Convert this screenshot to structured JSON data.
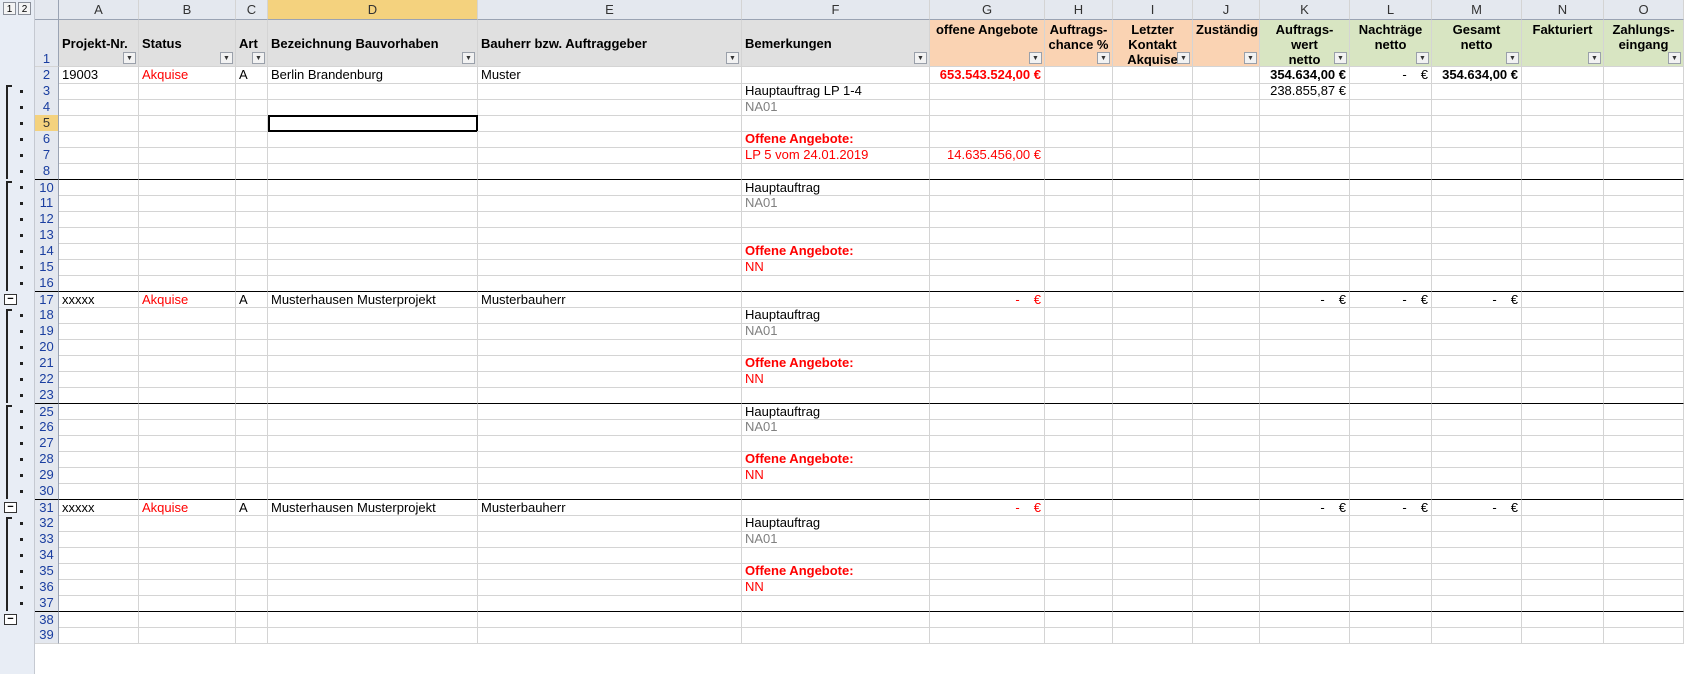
{
  "outline": {
    "levels": [
      "1",
      "2"
    ]
  },
  "columns": [
    "A",
    "B",
    "C",
    "D",
    "E",
    "F",
    "G",
    "H",
    "I",
    "J",
    "K",
    "L",
    "M",
    "N",
    "O"
  ],
  "active_column": "D",
  "header_row_number": "1",
  "headers": {
    "A": "Projekt-Nr.",
    "B": "Status",
    "C": "Art",
    "D": "Bezeichnung Bauvorhaben",
    "E": "Bauherr bzw. Auftraggeber",
    "F": "Bemerkungen",
    "G": "offene Angebote",
    "H": "Auftrags-\nchance %",
    "I": "Letzter\nKontakt\nAkquise",
    "J": "Zuständig",
    "K": "Auftrags-\nwert\nnetto",
    "L": "Nachträge\nnetto",
    "M": "Gesamt\nnetto",
    "N": "Fakturiert",
    "O": "Zahlungs-\neingang"
  },
  "rows": [
    {
      "n": "2",
      "A": "19003",
      "B": "Akquise",
      "C": "A",
      "D": "Berlin Brandenburg",
      "E": "Muster",
      "F": "",
      "G": "653.543.524,00 €",
      "K": "354.634,00 €",
      "L": "-",
      "L2": "€",
      "M": "354.634,00 €"
    },
    {
      "n": "3",
      "F": "Hauptauftrag LP 1-4",
      "K": "238.855,87 €"
    },
    {
      "n": "4",
      "F": "NA01"
    },
    {
      "n": "5",
      "selected": true
    },
    {
      "n": "6",
      "F": "Offene Angebote:"
    },
    {
      "n": "7",
      "F": "LP 5 vom 24.01.2019",
      "G": "14.635.456,00 €"
    },
    {
      "n": "8"
    },
    {
      "n": "10",
      "F": "Hauptauftrag",
      "sep": true
    },
    {
      "n": "11",
      "F": "NA01"
    },
    {
      "n": "12"
    },
    {
      "n": "13"
    },
    {
      "n": "14",
      "F": "Offene Angebote:"
    },
    {
      "n": "15",
      "F": "NN"
    },
    {
      "n": "16"
    },
    {
      "n": "17",
      "A": "xxxxx",
      "B": "Akquise",
      "C": "A",
      "D": "Musterhausen Musterprojekt",
      "E": "Musterbauherr",
      "G": "-",
      "G2": "€",
      "K": "-",
      "K2": "€",
      "L": "-",
      "L2": "€",
      "M": "-",
      "M2": "€",
      "sep": true
    },
    {
      "n": "18",
      "F": "Hauptauftrag"
    },
    {
      "n": "19",
      "F": "NA01"
    },
    {
      "n": "20"
    },
    {
      "n": "21",
      "F": "Offene Angebote:"
    },
    {
      "n": "22",
      "F": "NN"
    },
    {
      "n": "23"
    },
    {
      "n": "25",
      "F": "Hauptauftrag",
      "sep": true
    },
    {
      "n": "26",
      "F": "NA01"
    },
    {
      "n": "27"
    },
    {
      "n": "28",
      "F": "Offene Angebote:"
    },
    {
      "n": "29",
      "F": "NN"
    },
    {
      "n": "30"
    },
    {
      "n": "31",
      "A": "xxxxx",
      "B": "Akquise",
      "C": "A",
      "D": "Musterhausen Musterprojekt",
      "E": "Musterbauherr",
      "G": "-",
      "G2": "€",
      "K": "-",
      "K2": "€",
      "L": "-",
      "L2": "€",
      "M": "-",
      "M2": "€",
      "sep": true
    },
    {
      "n": "32",
      "F": "Hauptauftrag"
    },
    {
      "n": "33",
      "F": "NA01"
    },
    {
      "n": "34"
    },
    {
      "n": "35",
      "F": "Offene Angebote:"
    },
    {
      "n": "36",
      "F": "NN"
    },
    {
      "n": "37"
    },
    {
      "n": "38",
      "sep": true
    },
    {
      "n": "39"
    }
  ],
  "colors": {
    "red": "#ff0000",
    "orange_header": "#fad3b3",
    "green_header": "#d8e5c2",
    "gray_header": "#e0e0e0"
  }
}
